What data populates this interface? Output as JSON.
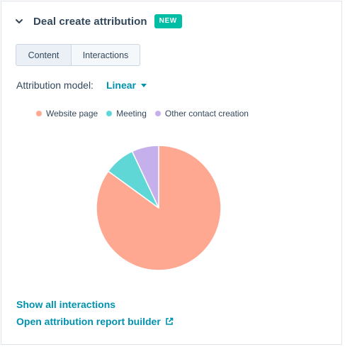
{
  "header": {
    "title": "Deal create attribution",
    "badge": "NEW"
  },
  "tabs": [
    {
      "label": "Content",
      "active": true
    },
    {
      "label": "Interactions",
      "active": false
    }
  ],
  "attribution": {
    "label": "Attribution model:",
    "selected": "Linear"
  },
  "chart_data": {
    "type": "pie",
    "categories": [
      "Website page",
      "Meeting",
      "Other contact creation"
    ],
    "values": [
      85,
      8,
      7
    ],
    "colors": [
      "#ffa891",
      "#5fd7d6",
      "#c6b0ec"
    ],
    "legend_position": "top"
  },
  "links": {
    "show_all": "Show all interactions",
    "open_builder": "Open attribution report builder"
  },
  "icons": {
    "collapse": "chevron-down-icon",
    "external": "external-link-icon"
  }
}
